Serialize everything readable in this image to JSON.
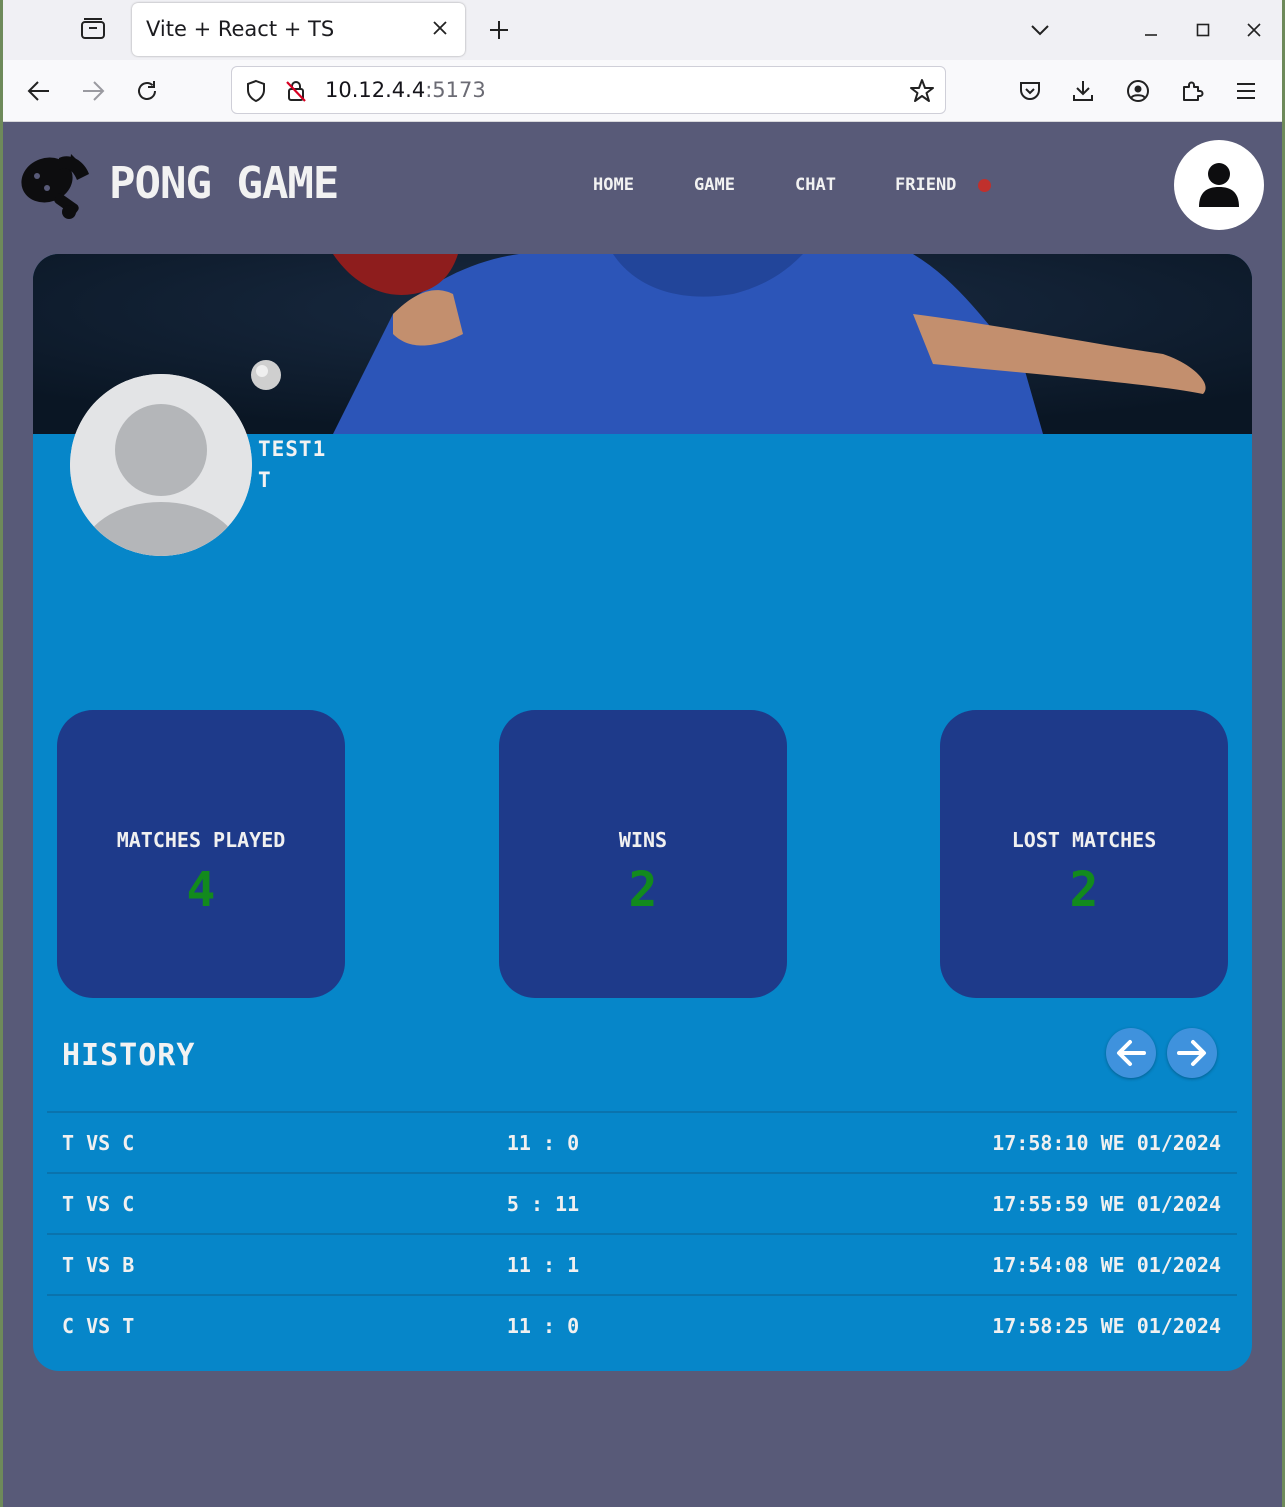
{
  "browser": {
    "tab_title": "Vite + React + TS",
    "url_host": "10.12.4.4",
    "url_port": ":5173"
  },
  "app": {
    "brand": "PONG GAME",
    "nav": {
      "home": "HOME",
      "game": "GAME",
      "chat": "CHAT",
      "friend": "FRIEND"
    },
    "colors": {
      "background": "#585a78",
      "card": "#0686c9",
      "stat_card": "#1e3a8a",
      "stat_value": "#128a1d",
      "notification": "#c0302c"
    }
  },
  "profile": {
    "username": "TEST1",
    "nickname": "T"
  },
  "stats": [
    {
      "label": "MATCHES PLAYED",
      "value": "4"
    },
    {
      "label": "WINS",
      "value": "2"
    },
    {
      "label": "LOST MATCHES",
      "value": "2"
    }
  ],
  "history": {
    "title": "HISTORY",
    "rows": [
      {
        "players": "T VS C",
        "score": "11 : 0",
        "date": "17:58:10 WE 01/2024"
      },
      {
        "players": "T VS C",
        "score": "5 : 11",
        "date": "17:55:59 WE 01/2024"
      },
      {
        "players": "T VS B",
        "score": "11 : 1",
        "date": "17:54:08 WE 01/2024"
      },
      {
        "players": "C VS T",
        "score": "11 : 0",
        "date": "17:58:25 WE 01/2024"
      }
    ]
  }
}
